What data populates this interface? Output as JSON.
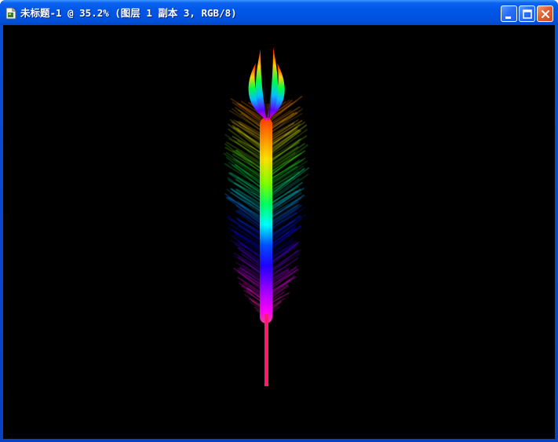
{
  "window": {
    "title": "未标题-1 @ 35.2% (图层 1 副本 3, RGB/8)",
    "icon": "photoshop-document-icon",
    "controls": {
      "minimize": "minimize-icon",
      "maximize": "maximize-icon",
      "close": "close-icon"
    }
  },
  "canvas": {
    "background_color": "#000000",
    "artwork": "rainbow-feather",
    "stem_color": "#ff1a6e",
    "gradient_colors": [
      "#ff3b00",
      "#ff8c00",
      "#ffe000",
      "#80ff00",
      "#00ff40",
      "#00ffff",
      "#0040ff",
      "#0000ff",
      "#8000ff",
      "#ff00ff",
      "#ff40a0"
    ]
  }
}
